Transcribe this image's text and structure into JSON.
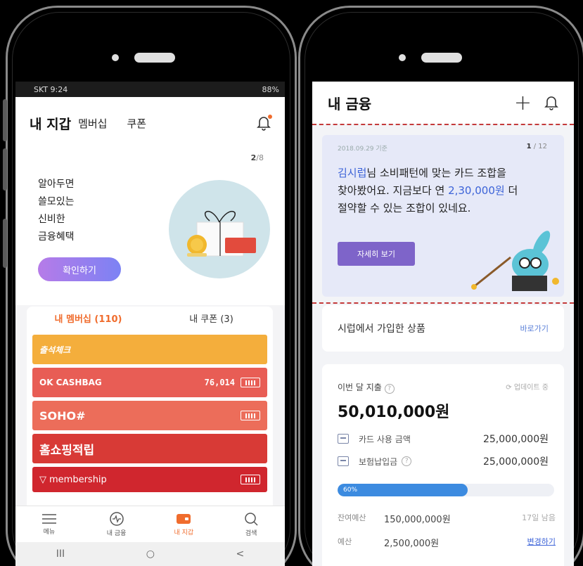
{
  "left": {
    "status": {
      "carrier_time": "SKT 9:24",
      "right": "88%"
    },
    "header": {
      "title": "내 지갑",
      "tab1": "멤버십",
      "tab2": "쿠폰"
    },
    "banner": {
      "page_current": "2",
      "page_total": "/8",
      "lines": [
        "알아두면",
        "쓸모있는",
        "신비한",
        "금융혜택"
      ],
      "button": "확인하기"
    },
    "tabs": {
      "membership": "내 멤버십 (110)",
      "coupon": "내 쿠폰 (3)"
    },
    "cards": [
      {
        "name": "출석체크",
        "color": "#f4ae3c",
        "amount": ""
      },
      {
        "name": "OK CASHBAG",
        "color": "#e85d55",
        "amount": "76,014"
      },
      {
        "name": "SOHO#",
        "color": "#ec6d5a",
        "amount": ""
      },
      {
        "name": "홈쇼핑적립",
        "color": "#d83a36",
        "amount": ""
      },
      {
        "name": "membership",
        "color": "#d0262e",
        "amount": ""
      }
    ],
    "nav": [
      {
        "label": "메뉴"
      },
      {
        "label": "내 금융"
      },
      {
        "label": "내 지갑"
      },
      {
        "label": "검색"
      }
    ],
    "sysnav": {
      "recent": "III",
      "home": "○",
      "back": "<"
    }
  },
  "right": {
    "header": {
      "title": "내 금융",
      "plus": "+"
    },
    "promo": {
      "date": "2018.09.29 기준",
      "page_current": "1",
      "page_total": " / 12",
      "name": "김시럽",
      "text1": "님 소비패턴에 맞는 카드 조합을",
      "text2": "찾아봤어요. 지금보다 연 ",
      "amount": "2,30,000원",
      "text3": " 더",
      "text4": "절약할 수 있는 조합이 있네요.",
      "button": "자세히 보기"
    },
    "joined": {
      "label": "시럽에서 가입한 상품",
      "link": "바로가기"
    },
    "spend": {
      "title": "이번 달 지출",
      "update": "업데이트 중",
      "total": "50,010,000원",
      "card_label": "카드 사용 금액",
      "card_value": "25,000,000원",
      "ins_label": "보험납입금",
      "ins_value": "25,000,000원",
      "progress": "60%",
      "progress_fraction": 0.6,
      "remain_label": "잔여예산",
      "remain_value": "150,000,000원",
      "days_left": "17일 남음",
      "budget_label": "예산",
      "budget_value": "2,500,000원",
      "change": "변경하기"
    }
  }
}
